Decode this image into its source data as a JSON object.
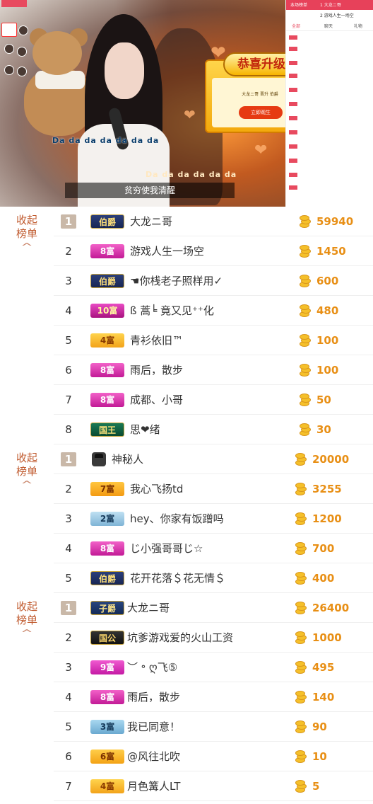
{
  "stream": {
    "lyric_a": "Da da da da da da da",
    "lyric_b": "Da da da da da da",
    "caption": "贫穷使我清醒",
    "upgrade_title": "恭喜升级",
    "upgrade_message": "大龙ニ哥 晋升 伯爵",
    "upgrade_button": "立即观生"
  },
  "chat": {
    "rank_rows": [
      {
        "num": "1",
        "name": "大龙ニ哥"
      },
      {
        "num": "2",
        "name": "游戏人生一场空"
      }
    ],
    "rank_label": "本场榜单",
    "tabs": [
      "全部",
      "聊天",
      "礼物"
    ]
  },
  "colors": {
    "accent": "#e84a5f",
    "amount": "#e88f15",
    "collapse_text": "#c05a2e"
  },
  "sections": [
    {
      "collapse_label": "收起榜单",
      "rows": [
        {
          "rank": "1",
          "badge": "伯爵",
          "badge_type": "boss",
          "name": "大龙ニ哥",
          "amount": "59940"
        },
        {
          "rank": "2",
          "badge": "8富",
          "badge_type": "rich8",
          "name": "游戏人生一场空",
          "amount": "1450"
        },
        {
          "rank": "3",
          "badge": "伯爵",
          "badge_type": "boss",
          "name": "☚你桟老子照样用✓",
          "amount": "600"
        },
        {
          "rank": "4",
          "badge": "10富",
          "badge_type": "rich10",
          "name": "ß 蒿╘ 竟又见⁺⁺化",
          "amount": "480"
        },
        {
          "rank": "5",
          "badge": "4富",
          "badge_type": "rich4",
          "name": "青衫依旧™",
          "amount": "100"
        },
        {
          "rank": "6",
          "badge": "8富",
          "badge_type": "rich8",
          "name": "雨后，散步",
          "amount": "100"
        },
        {
          "rank": "7",
          "badge": "8富",
          "badge_type": "rich8",
          "name": "成都、小哥",
          "amount": "50"
        },
        {
          "rank": "8",
          "badge": "国王",
          "badge_type": "king",
          "name": "思❤绪",
          "amount": "30"
        }
      ]
    },
    {
      "collapse_label": "收起榜单",
      "rows": [
        {
          "rank": "1",
          "badge": "",
          "badge_type": "mystery",
          "name": "神秘人",
          "amount": "20000"
        },
        {
          "rank": "2",
          "badge": "7富",
          "badge_type": "rich7",
          "name": "我心飞扬td",
          "amount": "3255"
        },
        {
          "rank": "3",
          "badge": "2富",
          "badge_type": "rich2",
          "name": "hey、你家有饭蹭吗",
          "amount": "1200"
        },
        {
          "rank": "4",
          "badge": "8富",
          "badge_type": "rich8",
          "name": "じ小强哥哥じ☆",
          "amount": "700"
        },
        {
          "rank": "5",
          "badge": "伯爵",
          "badge_type": "boss",
          "name": "花开花落＄花无情＄",
          "amount": "400"
        }
      ]
    },
    {
      "collapse_label": "收起榜单",
      "rows": [
        {
          "rank": "1",
          "badge": "子爵",
          "badge_type": "zi",
          "name": "大龙ニ哥",
          "amount": "26400"
        },
        {
          "rank": "2",
          "badge": "国公",
          "badge_type": "duke",
          "name": "坑爹游戏爱的火山工资",
          "amount": "1000"
        },
        {
          "rank": "3",
          "badge": "9富",
          "badge_type": "rich9",
          "name": "︶ ॰ ღ飞⑤",
          "amount": "495"
        },
        {
          "rank": "4",
          "badge": "8富",
          "badge_type": "rich8",
          "name": "雨后，散步",
          "amount": "140"
        },
        {
          "rank": "5",
          "badge": "3富",
          "badge_type": "rich3",
          "name": "我已同意！",
          "amount": "90"
        },
        {
          "rank": "6",
          "badge": "6富",
          "badge_type": "rich6",
          "name": "@风往北吹",
          "amount": "10"
        },
        {
          "rank": "7",
          "badge": "4富",
          "badge_type": "rich4",
          "name": "月色篝人LT",
          "amount": "5"
        }
      ]
    }
  ]
}
